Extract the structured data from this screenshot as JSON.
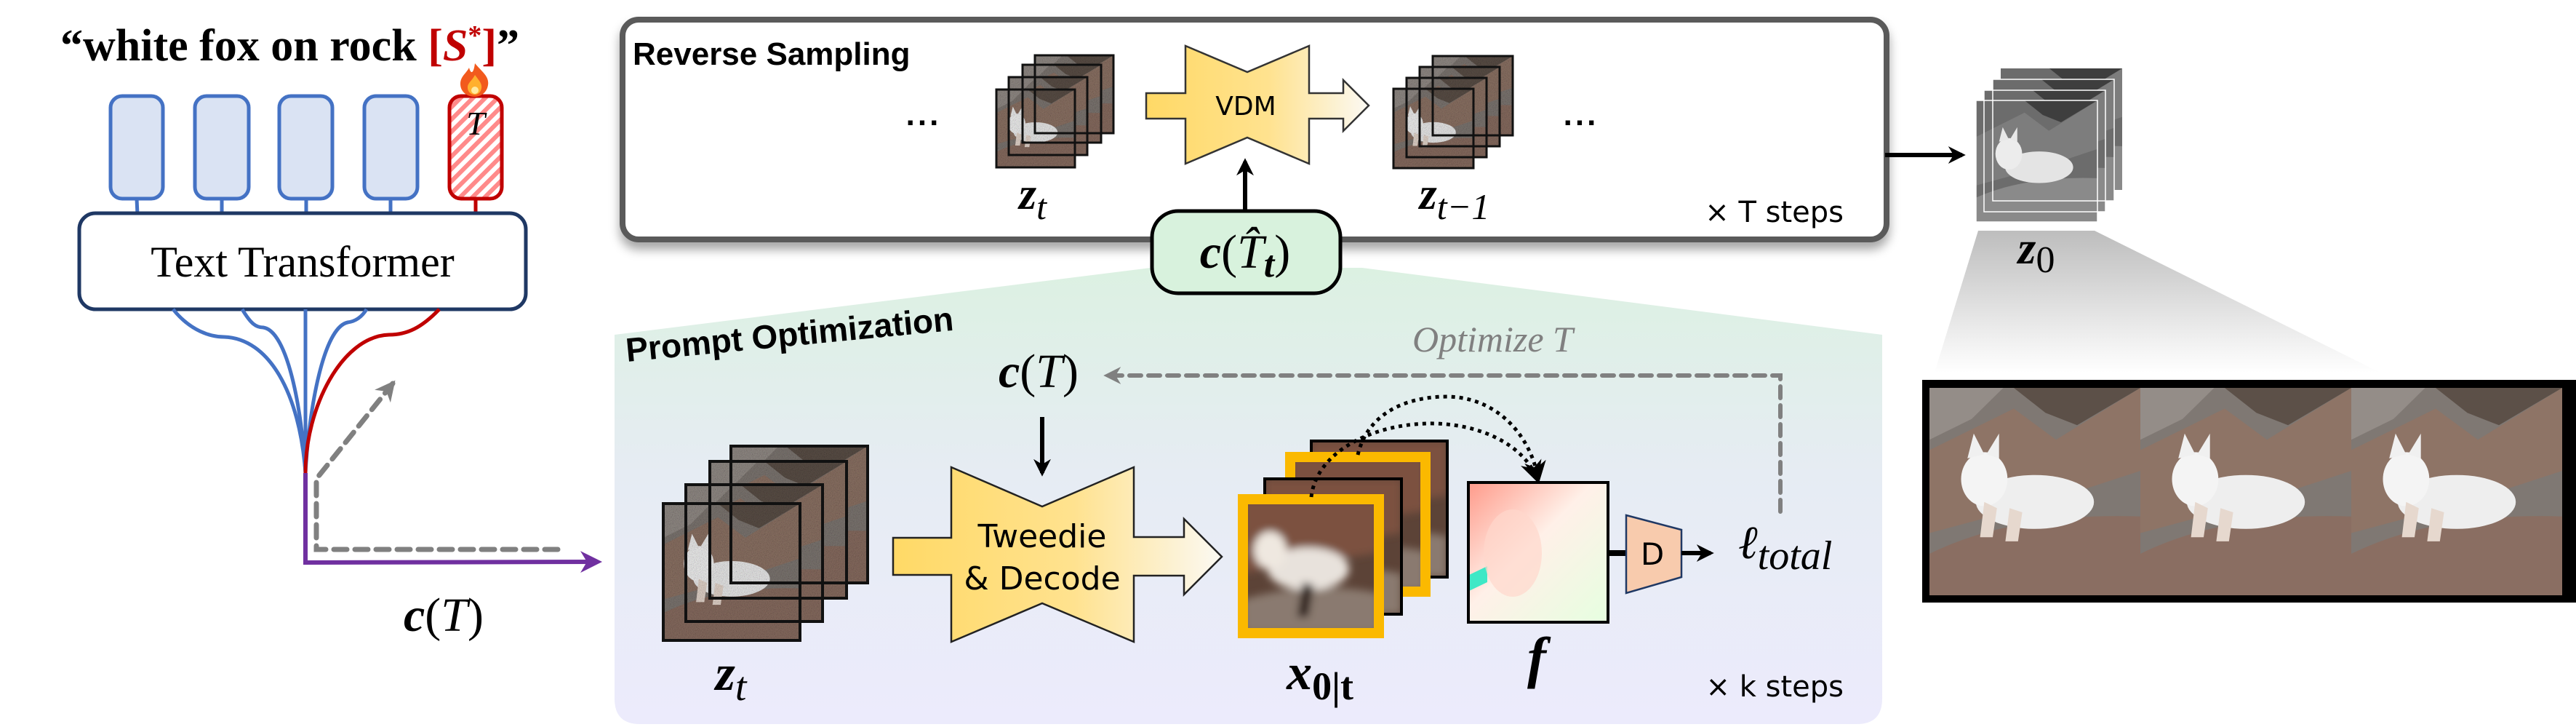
{
  "prompt": {
    "open_quote": "“",
    "text": "white fox on rock ",
    "token_open": "[",
    "token_symbol": "S",
    "token_sup": "*",
    "token_close": "]",
    "close_quote": "”"
  },
  "learnable_token": {
    "symbol": "T",
    "icon": "flame-icon"
  },
  "text_encoder": {
    "label": "Text Transformer"
  },
  "embedding_label": {
    "c": "c",
    "open": "(",
    "T": "T",
    "close": ")"
  },
  "reverse_sampling": {
    "title": "Reverse Sampling",
    "ellipsis_left": "...",
    "ellipsis_right": "...",
    "model": "VDM",
    "z_t": {
      "base": "z",
      "sub": "t"
    },
    "z_t_minus_1": {
      "base": "z",
      "sub": "t−1"
    },
    "steps": "× T steps",
    "condition": {
      "c": "c",
      "open": "(",
      "T": "T̂",
      "sub": "t",
      "close": ")"
    }
  },
  "output": {
    "z0": {
      "base": "z",
      "sub": "0"
    }
  },
  "prompt_optimization": {
    "title": "Prompt Optimization",
    "condition": {
      "c": "c",
      "open": "(",
      "T": "T",
      "close": ")"
    },
    "optimize_label": {
      "text": "Optimize ",
      "T": "T"
    },
    "decoder": {
      "line1": "Tweedie",
      "line2": "& Decode"
    },
    "z_t": {
      "base": "z",
      "sub": "t"
    },
    "x0t": {
      "base": "x",
      "sub": "0|t"
    },
    "flow": "f",
    "discriminator": "D",
    "loss": {
      "base": "ℓ",
      "sub": "total"
    },
    "steps": "× k steps"
  },
  "colors": {
    "token_blue": "#4472c4",
    "token_fill": "#dae3f3",
    "token_red": "#c00000",
    "embedding_purple": "#7030a0",
    "model_yellow": "#ffd966",
    "condition_green": "#d8f2dd",
    "frame_orange": "#fbb900",
    "discriminator_peach": "#f8cbad",
    "dashed_gray": "#808080"
  }
}
